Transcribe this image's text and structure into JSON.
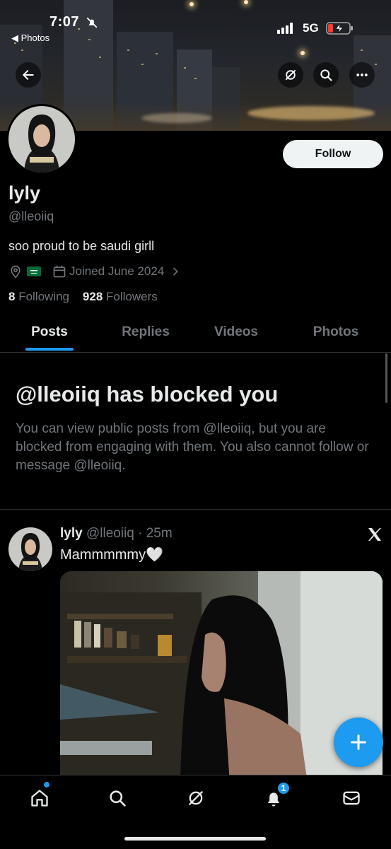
{
  "status_bar": {
    "time": "7:07",
    "back_app": "◀ Photos",
    "network": "5G"
  },
  "profile": {
    "display_name": "lyly",
    "handle": "@lleoiiq",
    "bio": "soo proud to be saudi girll",
    "joined": "Joined June 2024",
    "following_count": "8",
    "following_label": "Following",
    "followers_count": "928",
    "followers_label": "Followers",
    "follow_label": "Follow"
  },
  "tabs": [
    {
      "label": "Posts",
      "active": true
    },
    {
      "label": "Replies",
      "active": false
    },
    {
      "label": "Videos",
      "active": false
    },
    {
      "label": "Photos",
      "active": false
    }
  ],
  "blocked": {
    "title": "@lleoiiq has blocked you",
    "text": "You can view public posts from @lleoiiq, but you are blocked from engaging with them. You also cannot follow or message @lleoiiq."
  },
  "post": {
    "author": "lyly",
    "meta": "@lleoiiq · 25m",
    "text": "Mammmmmy🤍"
  },
  "nav": {
    "notification_count": "1"
  },
  "colors": {
    "accent": "#1d9bf0",
    "background": "#000000",
    "muted_text": "#71767b",
    "follow_button": "#eff3f4"
  },
  "icons": [
    "back-arrow-icon",
    "grok-icon",
    "search-icon",
    "more-icon",
    "location-icon",
    "saudi-flag-icon",
    "calendar-icon",
    "chevron-right-icon",
    "x-logo-icon",
    "plus-icon",
    "home-icon",
    "search-icon",
    "grok-icon",
    "bell-icon",
    "mail-icon"
  ]
}
